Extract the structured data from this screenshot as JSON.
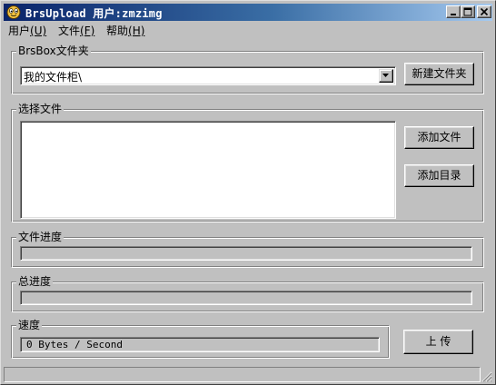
{
  "window": {
    "app_name": "BrsUpload",
    "user_label": "用户:zmzimg",
    "icon": "app-face-icon"
  },
  "title_buttons": [
    "minimize-icon",
    "maximize-icon",
    "close-icon"
  ],
  "menu": {
    "user": {
      "label": "用户",
      "accel": "(U)"
    },
    "file": {
      "label": "文件",
      "accel": "(F)"
    },
    "help": {
      "label": "帮助",
      "accel": "(H)"
    }
  },
  "folder_group": {
    "label": "BrsBox文件夹",
    "selected_folder": "我的文件柜\\",
    "new_folder_button": "新建文件夹"
  },
  "select_group": {
    "label": "选择文件",
    "files": [],
    "add_file_button": "添加文件",
    "add_dir_button": "添加目录"
  },
  "file_progress": {
    "label": "文件进度",
    "value": 0
  },
  "total_progress": {
    "label": "总进度",
    "value": 0
  },
  "speed": {
    "label": "速度",
    "value": "0 Bytes / Second"
  },
  "upload_button": "上 传",
  "colors": {
    "titlebar_start": "#0a246a",
    "titlebar_end": "#a6caf0",
    "face": "#c0c0c0"
  }
}
